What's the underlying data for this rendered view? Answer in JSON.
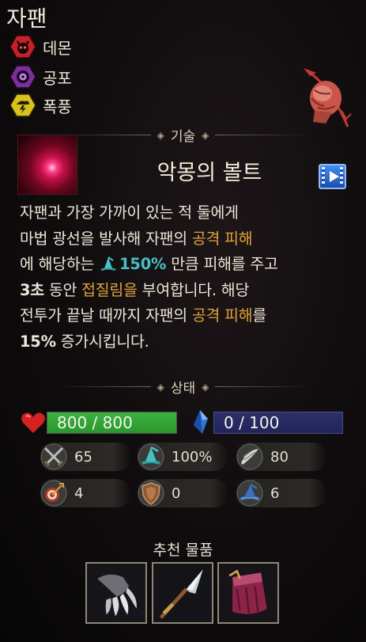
{
  "champion": {
    "name": "자팬",
    "traits": [
      {
        "label": "데몬",
        "icon": "demon-trait-icon",
        "color": "#c8202a"
      },
      {
        "label": "공포",
        "icon": "eye-trait-icon",
        "color": "#7b2f9a"
      },
      {
        "label": "폭풍",
        "icon": "storm-trait-icon",
        "color": "#d9c21c"
      }
    ]
  },
  "skill": {
    "section_label": "기술",
    "name": "악몽의 볼트",
    "description": {
      "l1": "자팬과 가장 가까이 있는 적 둘에게",
      "l2a": "마법 광선을 발사해 자팬의 ",
      "l2b": "공격 피해",
      "l3a": "에 해당하는 ",
      "l3b": "150%",
      "l3c": " 만큼 피해를 주고",
      "l4a": "3초",
      "l4b": " 동안 ",
      "l4c": "접질림을",
      "l4d": " 부여합니다. 해당",
      "l5a": "전투가 끝날 때까지 자팬의 ",
      "l5b": "공격 피해",
      "l5c": "를",
      "l6a": "15%",
      "l6b": " 증가시킵니다."
    }
  },
  "stats": {
    "section_label": "상태",
    "health": {
      "text": "800 / 800",
      "current": 800,
      "max": 800
    },
    "mana": {
      "text": "0 / 100",
      "current": 0,
      "max": 100
    },
    "row1": [
      {
        "icon": "attack-damage-icon",
        "value": "65"
      },
      {
        "icon": "ability-power-icon",
        "value": "100%"
      },
      {
        "icon": "attack-speed-icon",
        "value": "80"
      }
    ],
    "row2": [
      {
        "icon": "attack-range-icon",
        "value": "4"
      },
      {
        "icon": "armor-icon",
        "value": "0"
      },
      {
        "icon": "magic-resist-icon",
        "value": "6"
      }
    ]
  },
  "recommended": {
    "label": "추천 물품",
    "items": [
      "claw-item-icon",
      "spear-item-icon",
      "cloak-item-icon"
    ]
  },
  "colors": {
    "gold": "#e2a33a",
    "teal": "#46c1c4",
    "hp": "#2fa533",
    "mana": "#27295f"
  }
}
